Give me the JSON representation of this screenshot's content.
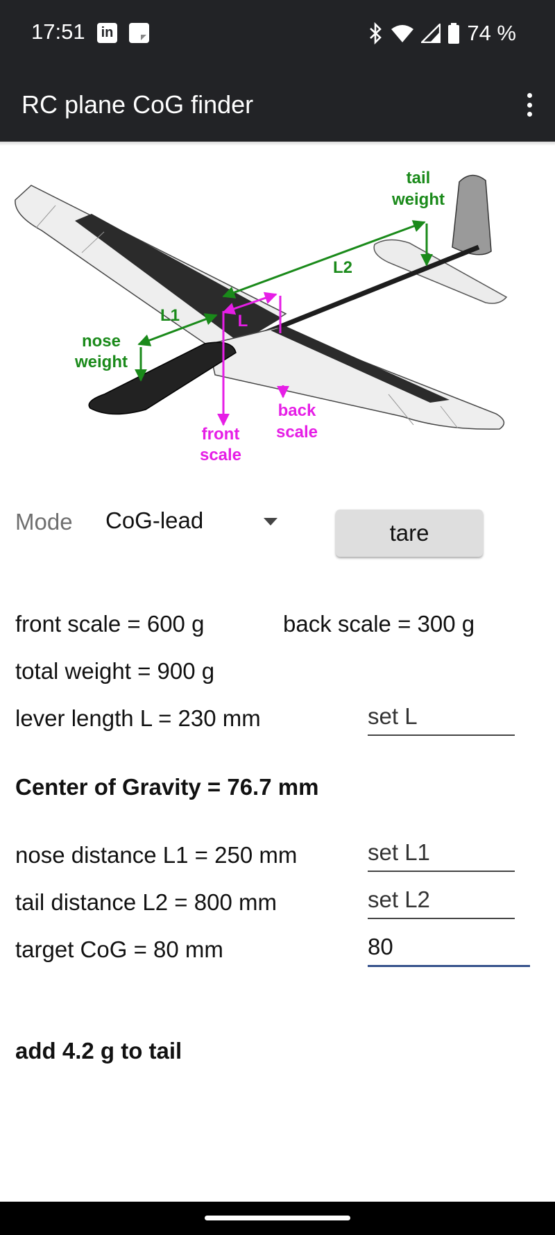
{
  "status_bar": {
    "time": "17:51",
    "notification_icons": [
      "linkedin-icon",
      "notes-icon"
    ],
    "system_icons": [
      "bluetooth-icon",
      "wifi-icon",
      "signal-icon",
      "battery-icon"
    ],
    "battery": "74 %"
  },
  "app_bar": {
    "title": "RC plane CoG finder",
    "menu_icon": "overflow-menu-icon"
  },
  "diagram": {
    "labels": {
      "tail_weight_1": "tail",
      "tail_weight_2": "weight",
      "l2": "L2",
      "l1": "L1",
      "l": "L",
      "nose_weight_1": "nose",
      "nose_weight_2": "weight",
      "back_scale_1": "back",
      "back_scale_2": "scale",
      "front_scale_1": "front",
      "front_scale_2": "scale"
    },
    "colors": {
      "green": "#1a8a1a",
      "magenta": "#e61ee6",
      "wing": "#eeeeee",
      "spar": "#2a2a2a"
    }
  },
  "controls": {
    "mode_label": "Mode",
    "mode_value": "CoG-lead",
    "tare_label": "tare"
  },
  "readings": {
    "front_scale": "front scale = 600 g",
    "back_scale": "back scale = 300 g",
    "total_weight": "total weight = 900 g",
    "lever_length": "lever length L = 230 mm",
    "center_of_gravity": "Center of Gravity = 76.7 mm",
    "nose_distance": "nose distance L1 = 250 mm",
    "tail_distance": "tail distance L2 = 800 mm",
    "target_cog": "target CoG = 80 mm",
    "result": "add 4.2 g  to tail"
  },
  "inputs": {
    "set_l_placeholder": "set L",
    "set_l1_placeholder": "set L1",
    "set_l2_placeholder": "set L2",
    "target_cog_value": "80"
  }
}
